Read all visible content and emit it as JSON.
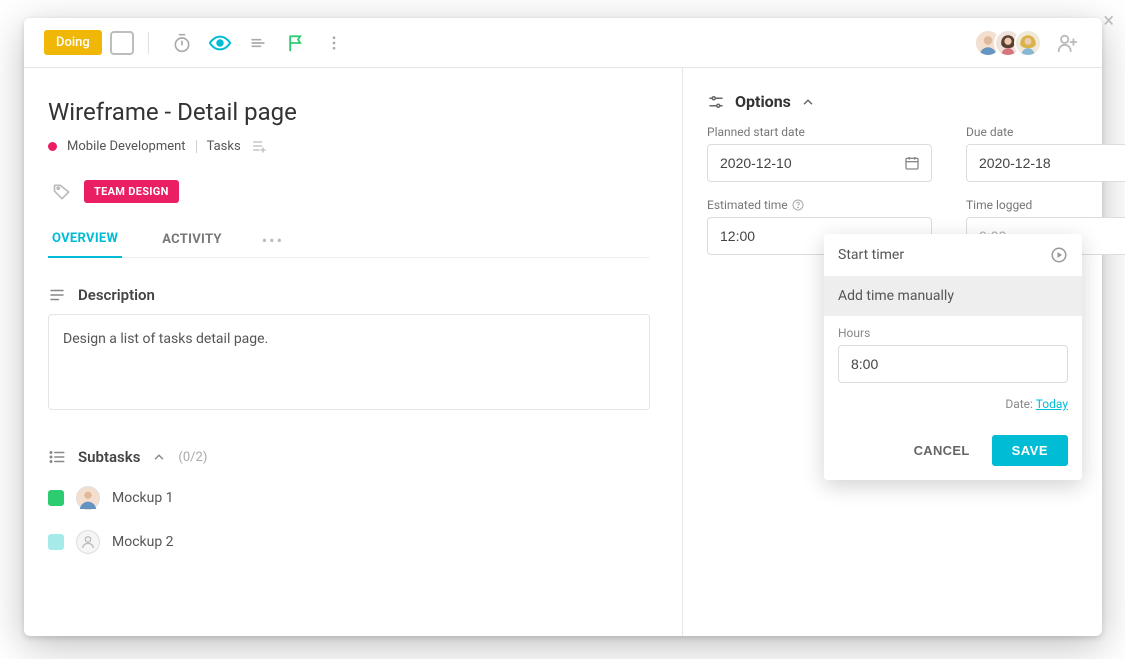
{
  "header": {
    "status_label": "Doing",
    "avatar_count": 3
  },
  "task": {
    "title": "Wireframe - Detail page",
    "project": "Mobile Development",
    "section": "Tasks",
    "tag": "TEAM DESIGN"
  },
  "tabs": {
    "overview": "OVERVIEW",
    "activity": "ACTIVITY"
  },
  "description": {
    "heading": "Description",
    "text": "Design a list of tasks detail page."
  },
  "subtasks": {
    "heading": "Subtasks",
    "count": "(0/2)",
    "items": [
      {
        "name": "Mockup 1"
      },
      {
        "name": "Mockup 2"
      }
    ]
  },
  "options": {
    "heading": "Options",
    "planned_start_label": "Planned start date",
    "planned_start_value": "2020-12-10",
    "due_date_label": "Due date",
    "due_date_value": "2020-12-18",
    "estimated_label": "Estimated time",
    "estimated_value": "12:00",
    "logged_label": "Time logged",
    "logged_value": "0:00"
  },
  "popover": {
    "start_timer": "Start timer",
    "add_manual": "Add time manually",
    "hours_label": "Hours",
    "hours_value": "8:00",
    "date_prefix": "Date: ",
    "date_link": "Today",
    "cancel": "CANCEL",
    "save": "SAVE"
  }
}
